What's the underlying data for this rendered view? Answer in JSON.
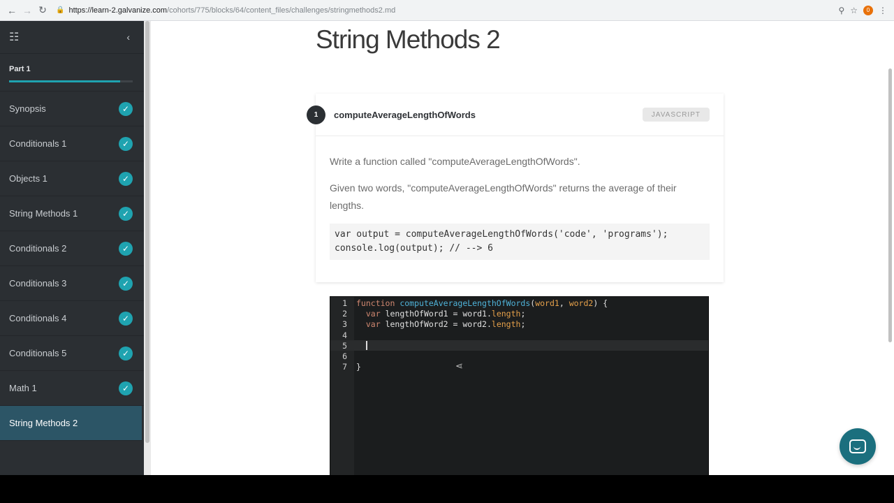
{
  "browser": {
    "url_host": "https://learn-2.galvanize.com",
    "url_path": "/cohorts/775/blocks/64/content_files/challenges/stringmethods2.md",
    "extension_badge": "0"
  },
  "sidebar": {
    "part_label": "Part 1",
    "progress": 0.9,
    "items": [
      {
        "label": "Synopsis",
        "done": true
      },
      {
        "label": "Conditionals 1",
        "done": true
      },
      {
        "label": "Objects 1",
        "done": true
      },
      {
        "label": "String Methods 1",
        "done": true
      },
      {
        "label": "Conditionals 2",
        "done": true
      },
      {
        "label": "Conditionals 3",
        "done": true
      },
      {
        "label": "Conditionals 4",
        "done": true
      },
      {
        "label": "Conditionals 5",
        "done": true
      },
      {
        "label": "Math 1",
        "done": true
      },
      {
        "label": "String Methods 2",
        "done": false,
        "active": true
      }
    ]
  },
  "page": {
    "title": "String Methods 2"
  },
  "challenge": {
    "number": "1",
    "name": "computeAverageLengthOfWords",
    "language": "JAVASCRIPT",
    "paragraph1": "Write a function called \"computeAverageLengthOfWords\".",
    "paragraph2": "Given two words, \"computeAverageLengthOfWords\" returns the average of their lengths.",
    "example_line1": "var output = computeAverageLengthOfWords('code', 'programs');",
    "example_line2": "console.log(output); // --> 6"
  },
  "editor": {
    "line_numbers": [
      "1",
      "2",
      "3",
      "4",
      "5",
      "6",
      "7"
    ],
    "current_line": 5
  },
  "colors": {
    "sidebar_bg": "#2b2f33",
    "accent": "#1fa3b0",
    "active_item": "#2c5566",
    "chat_button": "#1b6f7e"
  }
}
